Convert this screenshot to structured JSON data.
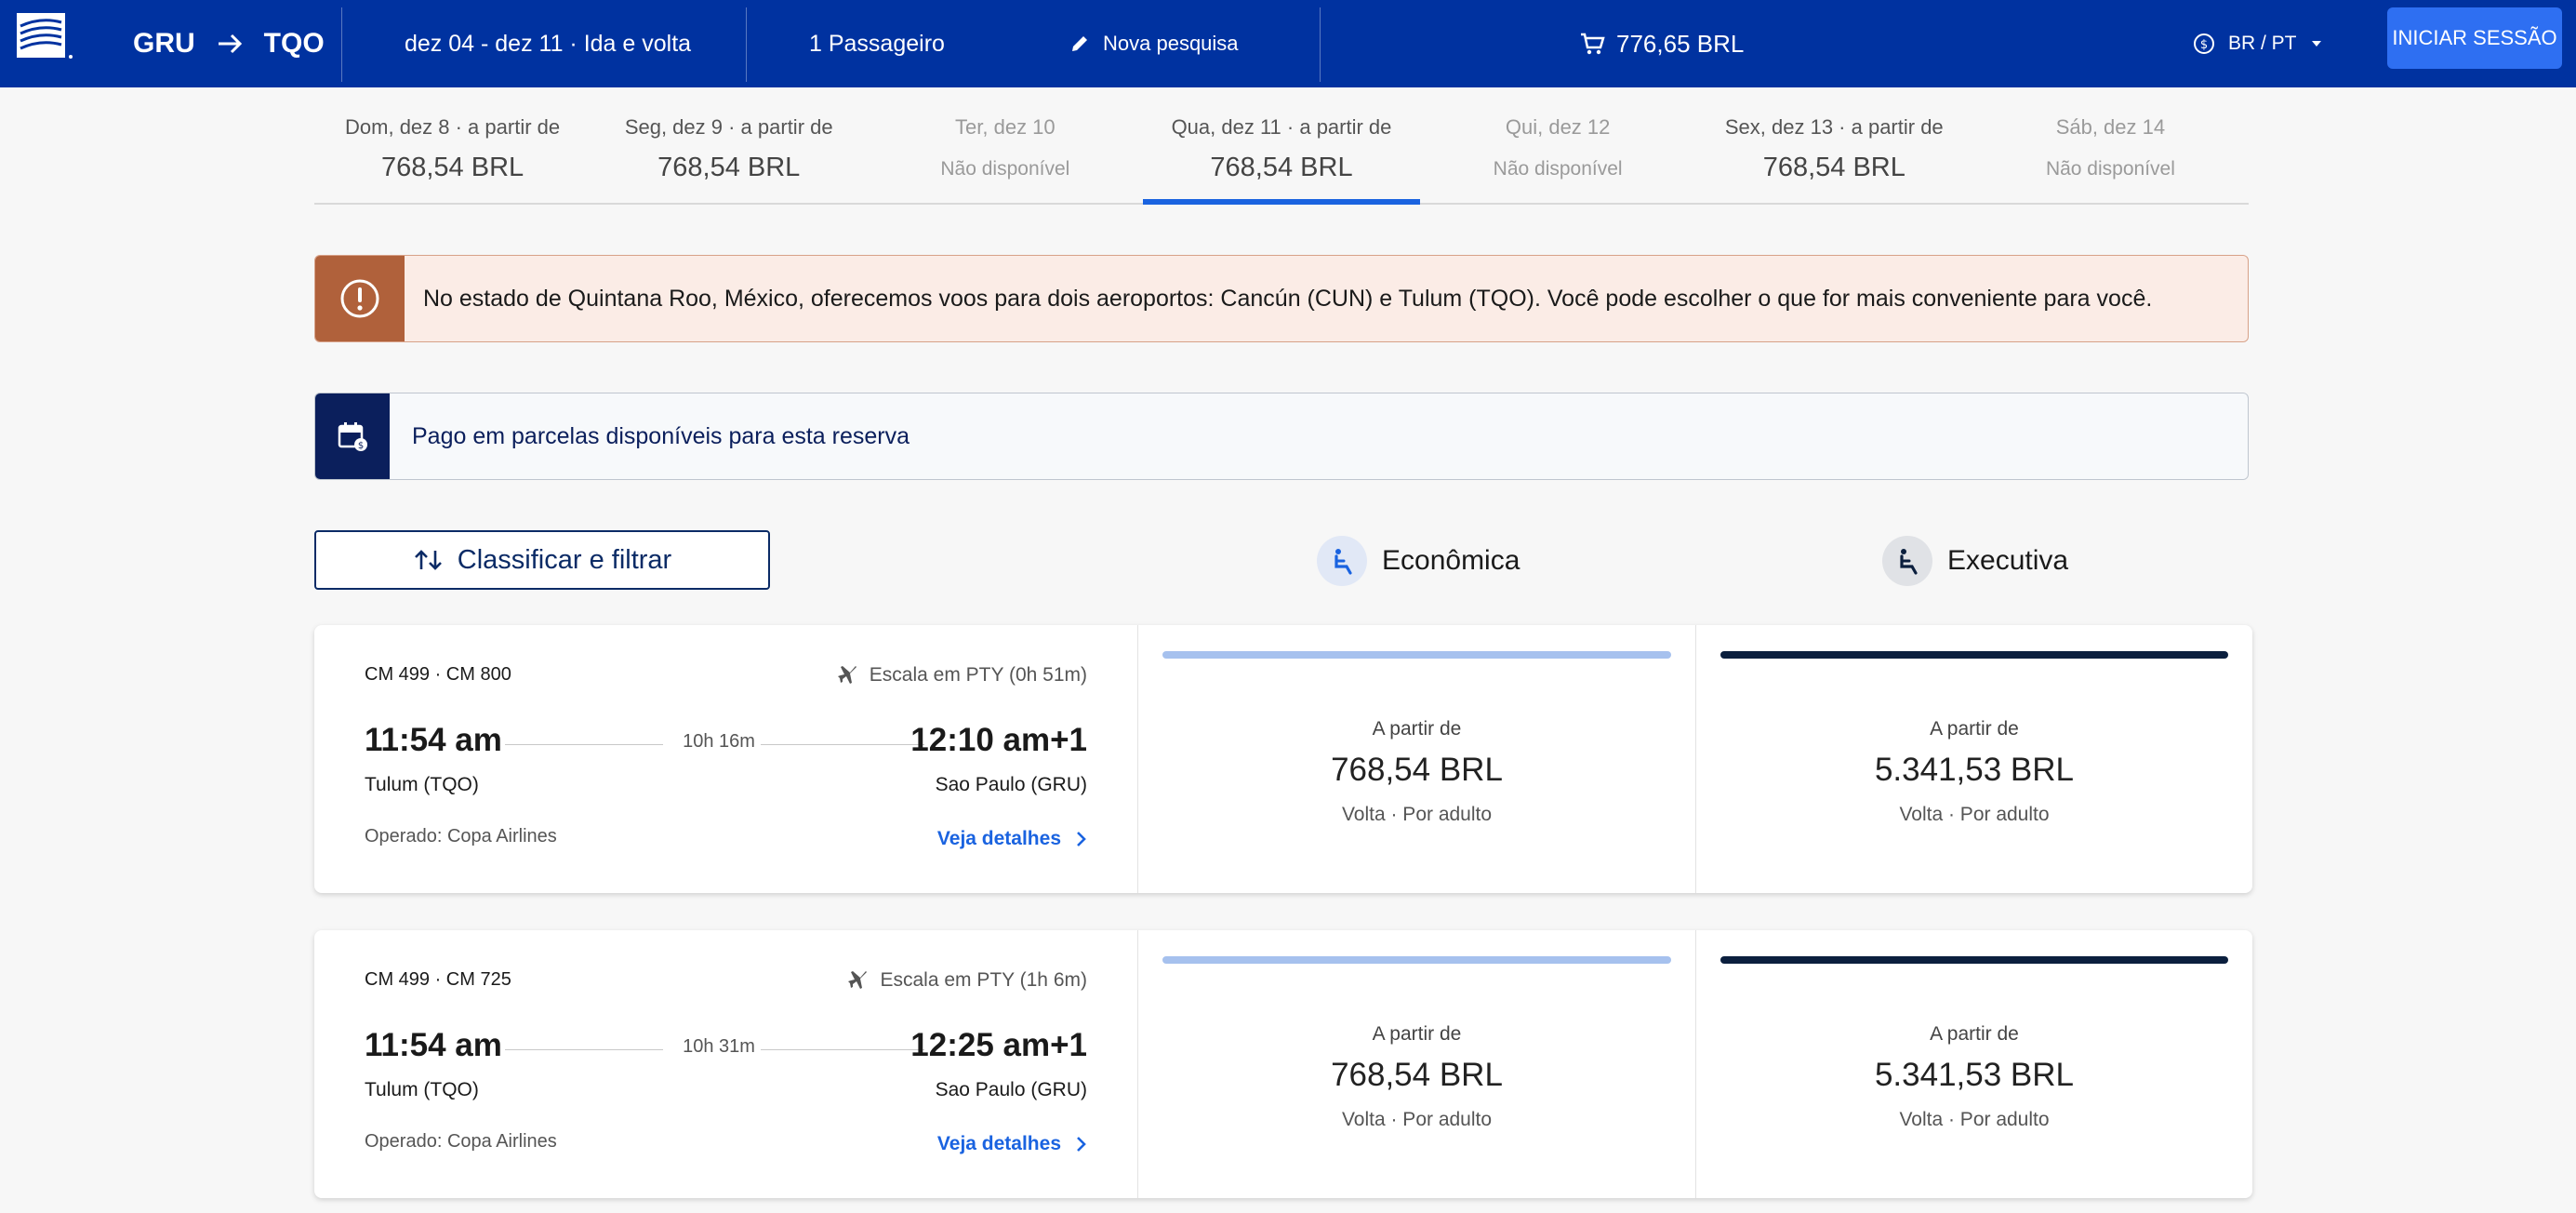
{
  "header": {
    "origin": "GRU",
    "destination": "TQO",
    "dates": "dez 04 - dez 11 · Ida e volta",
    "passengers": "1 Passageiro",
    "new_search": "Nova pesquisa",
    "cart_total": "776,65 BRL",
    "locale": "BR / PT",
    "login": "INICIAR SESSÃO"
  },
  "date_strip": [
    {
      "label": "Dom, dez 8 · a partir de",
      "price": "768,54 BRL",
      "available": true,
      "selected": false
    },
    {
      "label": "Seg, dez 9 · a partir de",
      "price": "768,54 BRL",
      "available": true,
      "selected": false
    },
    {
      "label": "Ter, dez 10",
      "price": "Não disponível",
      "available": false,
      "selected": false
    },
    {
      "label": "Qua, dez 11 · a partir de",
      "price": "768,54 BRL",
      "available": true,
      "selected": true
    },
    {
      "label": "Qui, dez 12",
      "price": "Não disponível",
      "available": false,
      "selected": false
    },
    {
      "label": "Sex, dez 13 · a partir de",
      "price": "768,54 BRL",
      "available": true,
      "selected": false
    },
    {
      "label": "Sáb, dez 14",
      "price": "Não disponível",
      "available": false,
      "selected": false
    }
  ],
  "alerts": {
    "info": "No estado de Quintana Roo, México, oferecemos voos para dois aeroportos: Cancún (CUN) e Tulum (TQO). Você pode escolher o que for mais conveniente para você.",
    "installments": "Pago em parcelas disponíveis para esta reserva"
  },
  "sort_filter": "Classificar e filtrar",
  "cabins": {
    "economy": "Econômica",
    "business": "Executiva"
  },
  "flights": [
    {
      "flight_numbers": "CM 499 · CM 800",
      "stop": "Escala em PTY (0h 51m)",
      "departure": "11:54 am",
      "duration": "10h 16m",
      "arrival": "12:10 am+1",
      "origin": "Tulum (TQO)",
      "destination": "Sao Paulo (GRU)",
      "operator": "Operado: Copa Airlines",
      "details": "Veja detalhes",
      "economy": {
        "from": "A partir de",
        "price": "768,54 BRL",
        "note": "Volta · Por adulto"
      },
      "business": {
        "from": "A partir de",
        "price": "5.341,53 BRL",
        "note": "Volta · Por adulto"
      }
    },
    {
      "flight_numbers": "CM 499 · CM 725",
      "stop": "Escala em PTY (1h 6m)",
      "departure": "11:54 am",
      "duration": "10h 31m",
      "arrival": "12:25 am+1",
      "origin": "Tulum (TQO)",
      "destination": "Sao Paulo (GRU)",
      "operator": "Operado: Copa Airlines",
      "details": "Veja detalhes",
      "economy": {
        "from": "A partir de",
        "price": "768,54 BRL",
        "note": "Volta · Por adulto"
      },
      "business": {
        "from": "A partir de",
        "price": "5.341,53 BRL",
        "note": "Volta · Por adulto"
      }
    }
  ],
  "colors": {
    "header_bg": "#0032a0",
    "login_bg": "#2e6ff2",
    "link": "#1a63e0",
    "info_side": "#b0613b",
    "pay_side": "#0b1f5c"
  }
}
